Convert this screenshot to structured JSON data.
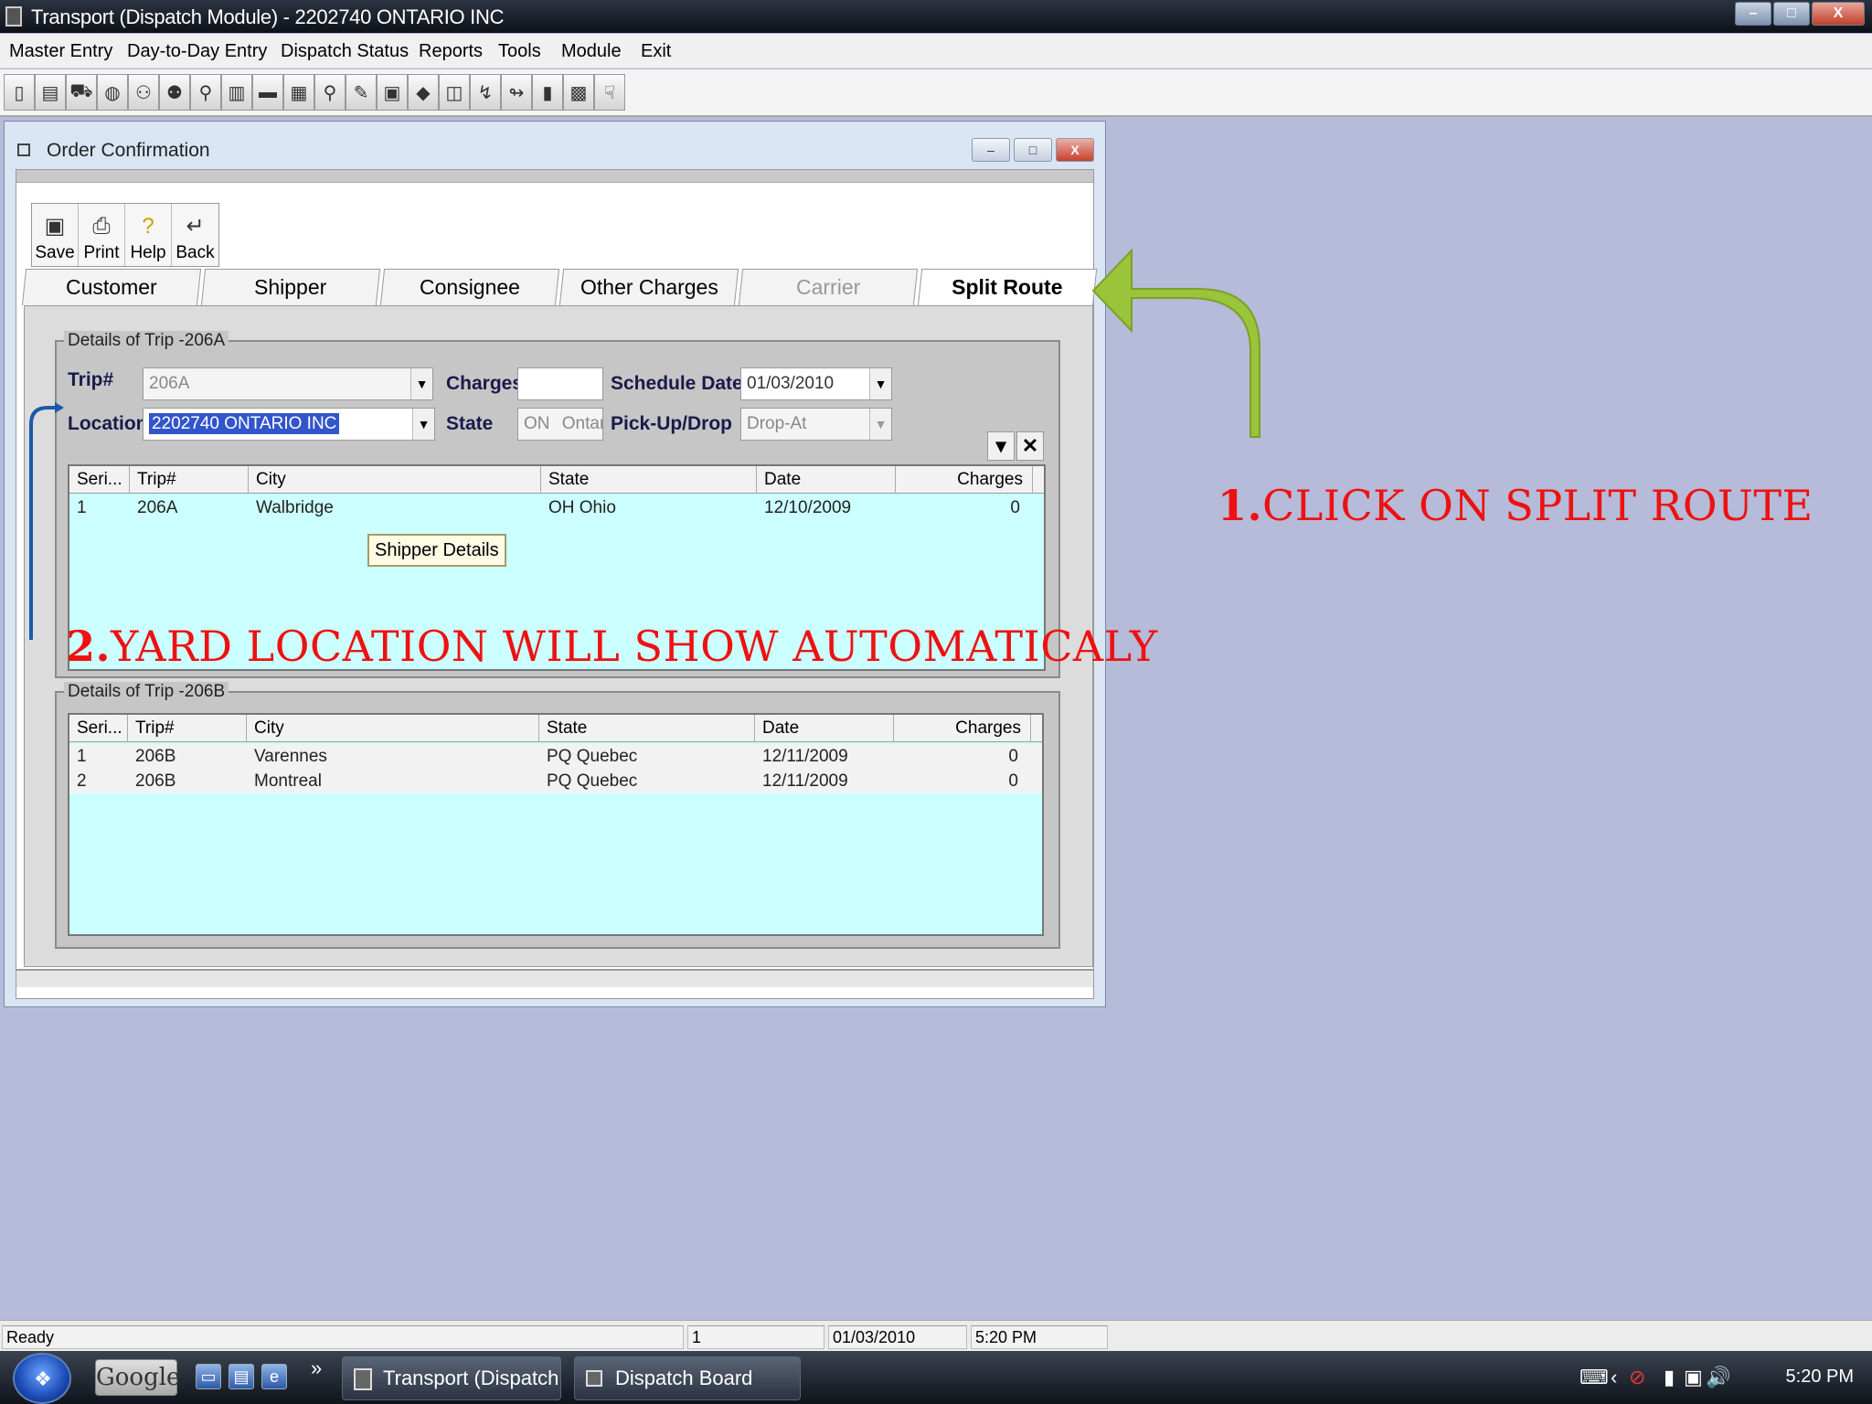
{
  "window": {
    "title": "Transport (Dispatch Module) - 2202740 ONTARIO INC",
    "min": "–",
    "max": "□",
    "close": "X"
  },
  "menu": [
    "Master Entry",
    "Day-to-Day Entry",
    "Dispatch Status",
    "Reports",
    "Tools",
    "Module",
    "Exit"
  ],
  "child": {
    "title": "Order Confirmation",
    "min": "–",
    "max": "□",
    "close": "X"
  },
  "form_buttons": [
    {
      "label": "Save",
      "icon": "save-icon",
      "glyph": "💾"
    },
    {
      "label": "Print",
      "icon": "print-icon",
      "glyph": "🖨"
    },
    {
      "label": "Help",
      "icon": "help-icon",
      "glyph": "?"
    },
    {
      "label": "Back",
      "icon": "back-icon",
      "glyph": "↵"
    }
  ],
  "tabs": [
    "Customer",
    "Shipper",
    "Consignee",
    "Other Charges",
    "Carrier",
    "Split Route"
  ],
  "trip_a": {
    "legend": "Details of Trip -206A",
    "trip_label": "Trip#",
    "trip_value": "206A",
    "charges_label": "Charges",
    "charges_value": "",
    "schedule_label": "Schedule Date",
    "schedule_value": "01/03/2010",
    "location_label": "Location",
    "location_value": "2202740 ONTARIO INC",
    "state_label": "State",
    "state_code": "ON",
    "state_name": "Ontario",
    "pickup_label": "Pick-Up/Drop",
    "pickup_value": "Drop-At",
    "columns": [
      "Seri...",
      "Trip#",
      "City",
      "State",
      "Date",
      "Charges"
    ],
    "rows": [
      {
        "seri": "1",
        "trip": "206A",
        "city": "Walbridge",
        "state": "OH  Ohio",
        "date": "12/10/2009",
        "charges": "0"
      }
    ]
  },
  "tooltip": "Shipper Details",
  "trip_b": {
    "legend": "Details of Trip -206B",
    "columns": [
      "Seri...",
      "Trip#",
      "City",
      "State",
      "Date",
      "Charges"
    ],
    "rows": [
      {
        "seri": "1",
        "trip": "206B",
        "city": "Varennes",
        "state": "PQ  Quebec",
        "date": "12/11/2009",
        "charges": "0"
      },
      {
        "seri": "2",
        "trip": "206B",
        "city": "Montreal",
        "state": "PQ  Quebec",
        "date": "12/11/2009",
        "charges": "0"
      }
    ]
  },
  "annotations": {
    "one_num": "1.",
    "one_text": "CLICK ON SPLIT ROUTE",
    "two_num": "2.",
    "two_text": "YARD LOCATION WILL SHOW AUTOMATICALY",
    "arrow_color": "#9ac43a",
    "line_color": "#1a5ba8"
  },
  "status": {
    "ready": "Ready",
    "page": "1",
    "date": "01/03/2010",
    "time": "5:20 PM"
  },
  "taskbar": {
    "google": "Google",
    "chevrons": "»",
    "tasks": [
      "Transport (Dispatch ...",
      "Dispatch Board Disp..."
    ],
    "clock": "5:20 PM"
  }
}
